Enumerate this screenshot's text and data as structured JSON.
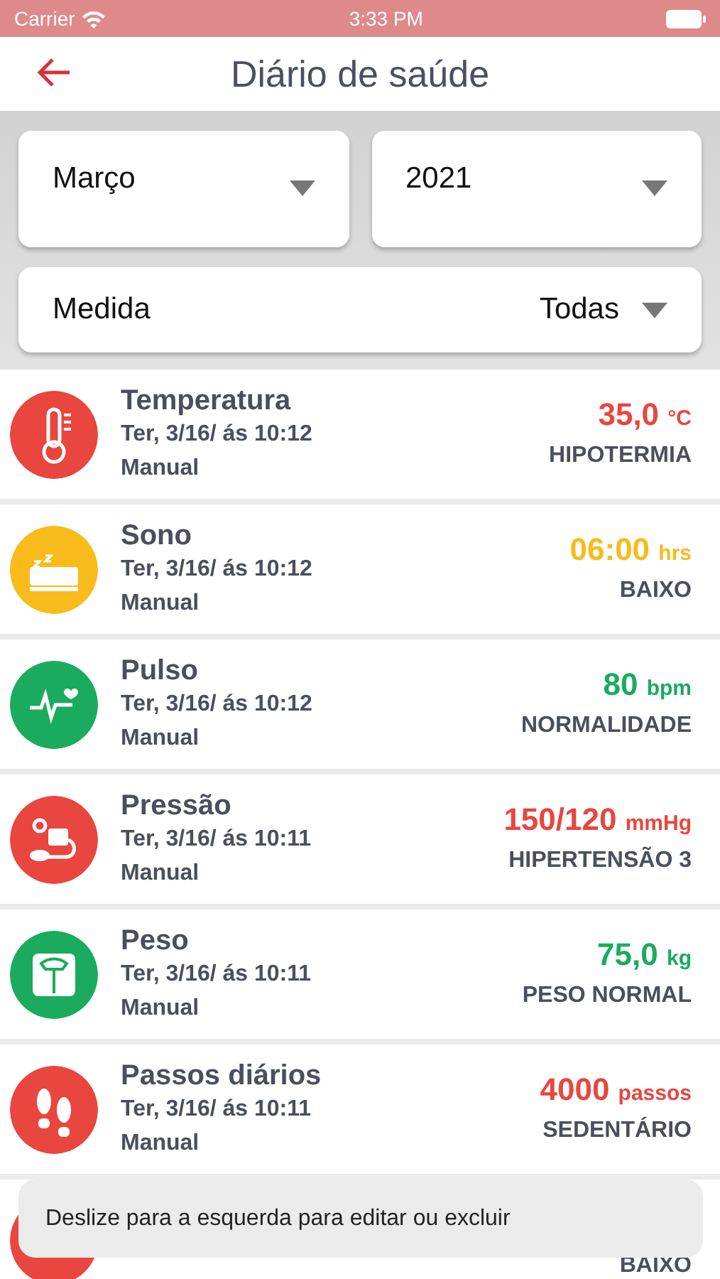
{
  "status_bar": {
    "carrier": "Carrier",
    "time": "3:33 PM"
  },
  "header": {
    "title": "Diário de saúde"
  },
  "filters": [
    {
      "value": "Março"
    },
    {
      "value": "2021"
    }
  ],
  "measure_filter": {
    "label": "Medida",
    "value": "Todas"
  },
  "entries": [
    {
      "kind": "temperature",
      "color": "#e8463e",
      "title": "Temperatura",
      "date": "Ter, 3/16/ ás 10:12",
      "source": "Manual",
      "value": "35,0",
      "unit": "°C",
      "status": "HIPOTERMIA"
    },
    {
      "kind": "sleep",
      "color": "#f8bb1b",
      "title": "Sono",
      "date": "Ter, 3/16/ ás 10:12",
      "source": "Manual",
      "value": "06:00",
      "unit": "hrs",
      "status": "BAIXO"
    },
    {
      "kind": "pulse",
      "color": "#1aab5e",
      "title": "Pulso",
      "date": "Ter, 3/16/ ás 10:12",
      "source": "Manual",
      "value": "80",
      "unit": "bpm",
      "status": "NORMALIDADE"
    },
    {
      "kind": "pressure",
      "color": "#e8463e",
      "title": "Pressão",
      "date": "Ter, 3/16/ ás 10:11",
      "source": "Manual",
      "value": "150/120",
      "unit": "mmHg",
      "status": "HIPERTENSÃO 3"
    },
    {
      "kind": "weight",
      "color": "#1aab5e",
      "title": "Peso",
      "date": "Ter, 3/16/ ás 10:11",
      "source": "Manual",
      "value": "75,0",
      "unit": "kg",
      "status": "PESO NORMAL"
    },
    {
      "kind": "steps",
      "color": "#e8463e",
      "title": "Passos diários",
      "date": "Ter, 3/16/ ás 10:11",
      "source": "Manual",
      "value": "4000",
      "unit": "passos",
      "status": "SEDENTÁRIO"
    },
    {
      "kind": "covered",
      "color": "#e8463e",
      "status": "BAIXO"
    }
  ],
  "toast": {
    "text": "Deslize para a esquerda para editar ou excluir"
  }
}
